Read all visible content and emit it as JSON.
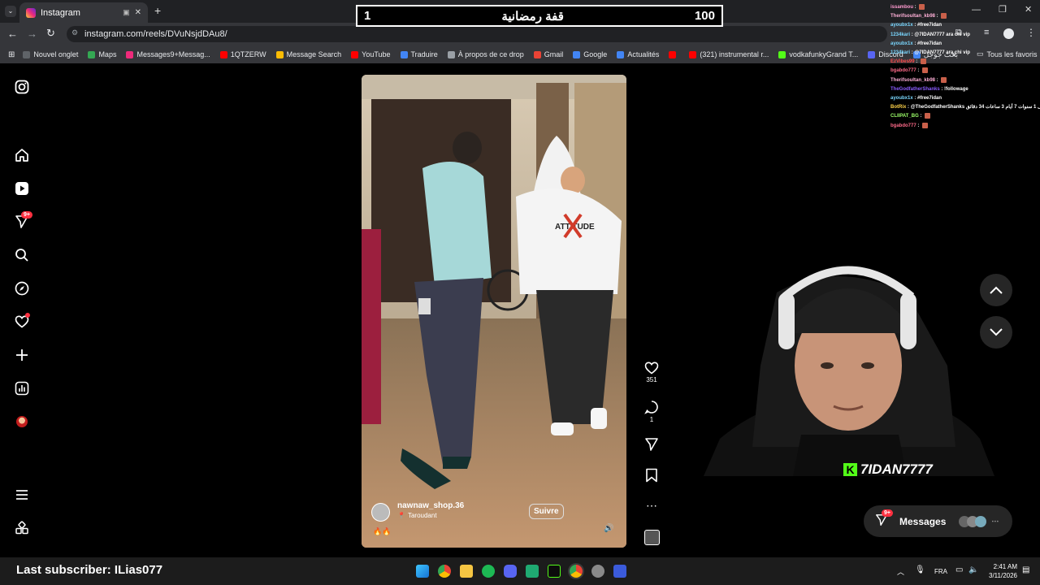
{
  "browser": {
    "tab_title": "Instagram",
    "url": "instagram.com/reels/DVuNsjdDAu8/",
    "bookmarks": [
      {
        "label": "Nouvel onglet",
        "color": "#5f6368"
      },
      {
        "label": "Maps",
        "color": "#34a853"
      },
      {
        "label": "Messages9+Messag...",
        "color": "#ee2a7b"
      },
      {
        "label": "1QTZERW",
        "color": "#ff0000"
      },
      {
        "label": "Message Search",
        "color": "#fbbc04"
      },
      {
        "label": "YouTube",
        "color": "#ff0000"
      },
      {
        "label": "Traduire",
        "color": "#4285f4"
      },
      {
        "label": "À propos de ce drop",
        "color": "#9aa0a6"
      },
      {
        "label": "Gmail",
        "color": "#ea4335"
      },
      {
        "label": "Google",
        "color": "#4285f4"
      },
      {
        "label": "Actualités",
        "color": "#4285f4"
      },
      {
        "label": "",
        "color": "#ff0000"
      },
      {
        "label": "(321) instrumental r...",
        "color": "#ff0000"
      },
      {
        "label": "vodkafunkyGrand T...",
        "color": "#53fc18"
      },
      {
        "label": "Discord",
        "color": "#5865f2"
      },
      {
        "label": "بحث جوجل",
        "color": "#4285f4"
      }
    ],
    "all_favorites": "Tous les favoris"
  },
  "stream": {
    "banner_left": "1",
    "banner_title": "قفة رمضانية",
    "banner_right": "100",
    "chat": [
      {
        "user": "issambou",
        "msg": "",
        "color": "#ff9bd1"
      },
      {
        "user": "Therifsoultan_kb98",
        "msg": "",
        "color": "#ffb0d8"
      },
      {
        "user": "ayoubx1x",
        "msg": "#free7idan",
        "color": "#7ad7ff"
      },
      {
        "user": "1234kari",
        "msg": "@7IDAN7777 ara chi vip",
        "color": "#7ad7ff"
      },
      {
        "user": "ayoubx1x",
        "msg": "#free7idan",
        "color": "#7ad7ff"
      },
      {
        "user": "1234kari",
        "msg": "@7IDAN7777 ara chi vip",
        "color": "#7ad7ff"
      },
      {
        "user": "EzVibes99",
        "msg": "",
        "color": "#ff4a4a"
      },
      {
        "user": "bgabdo777",
        "msg": "",
        "color": "#ff6b8a"
      },
      {
        "user": "Therifsoultan_kb98",
        "msg": "",
        "color": "#ffb0d8"
      },
      {
        "user": "TheGodfatherShanks",
        "msg": "!followage",
        "color": "#8a5cff"
      },
      {
        "user": "ayoubx1x",
        "msg": "#free7idan",
        "color": "#7ad7ff"
      },
      {
        "user": "BotRix",
        "msg": "@TheGodfatherShanks ل 1 سنوات 7 أيام 3 ساعات 34 دقائق",
        "color": "#ffd34a"
      },
      {
        "user": "CLIIPAT_BG",
        "msg": "",
        "color": "#9dff6a"
      },
      {
        "user": "bgabdo777",
        "msg": "",
        "color": "#ff6b8a"
      }
    ],
    "streamer_name": "7IDAN7777",
    "last_subscriber": "Last subscriber: ILias077"
  },
  "reel": {
    "username": "nawnaw_shop.36",
    "location": "Taroudant",
    "follow_label": "Suivre",
    "likes": "351",
    "comments": "1",
    "caption_emoji": "🔥🔥",
    "hoodie_text": "ATTITUDE"
  },
  "sidebar": {
    "notifications_badge": "9+"
  },
  "messages": {
    "label": "Messages",
    "badge": "9+"
  },
  "taskbar": {
    "lang": "FRA",
    "time": "2:41 AM",
    "date": "3/11/2026"
  },
  "colors": {
    "chrome_dark": "#202124",
    "chrome_mid": "#35363a",
    "ig_badge": "#ff3040",
    "kick_green": "#53fc18"
  }
}
